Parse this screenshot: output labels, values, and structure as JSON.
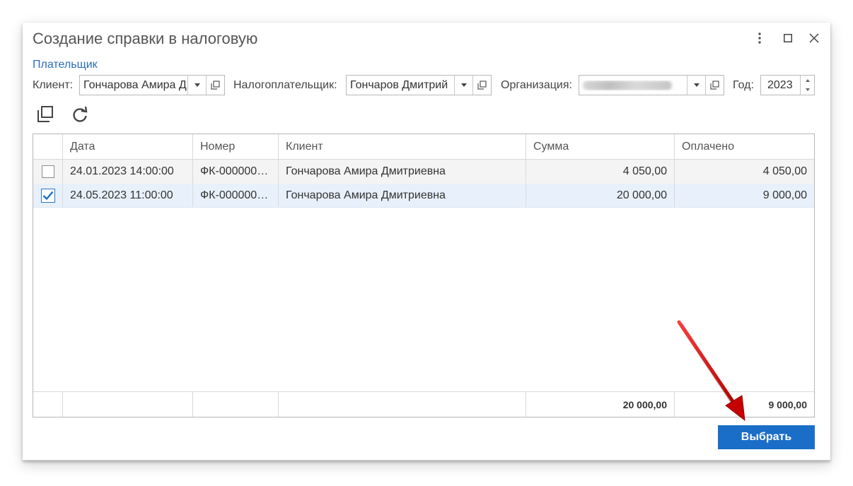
{
  "window": {
    "title": "Создание справки в налоговую"
  },
  "payer": {
    "label": "Плательщик",
    "client_label": "Клиент:",
    "client_value": "Гончарова Амира Д",
    "taxpayer_label": "Налогоплательщик:",
    "taxpayer_value": "Гончаров Дмитрий",
    "org_label": "Организация:",
    "year_label": "Год:",
    "year_value": "2023"
  },
  "table": {
    "columns": [
      "Дата",
      "Номер",
      "Клиент",
      "Сумма",
      "Оплачено"
    ],
    "rows": [
      {
        "checked": false,
        "date": "24.01.2023 14:00:00",
        "number": "ФК-000000…",
        "client": "Гончарова Амира Дмитриевна",
        "sum": "4 050,00",
        "paid": "4 050,00"
      },
      {
        "checked": true,
        "date": "24.05.2023 11:00:00",
        "number": "ФК-000000…",
        "client": "Гончарова Амира Дмитриевна",
        "sum": "20 000,00",
        "paid": "9 000,00"
      }
    ],
    "totals": {
      "sum": "20 000,00",
      "paid": "9 000,00"
    }
  },
  "actions": {
    "select_label": "Выбрать"
  },
  "colors": {
    "accent": "#1b6ec8",
    "link": "#2c6fb3",
    "selected_row": "#e8f1fb",
    "annotation_arrow": "#d40000"
  },
  "icons": [
    "more-vertical-icon",
    "maximize-icon",
    "close-icon",
    "dropdown-arrow-icon",
    "open-form-icon",
    "copy-icon",
    "refresh-icon",
    "checkmark-icon",
    "spin-up-icon",
    "spin-down-icon"
  ]
}
